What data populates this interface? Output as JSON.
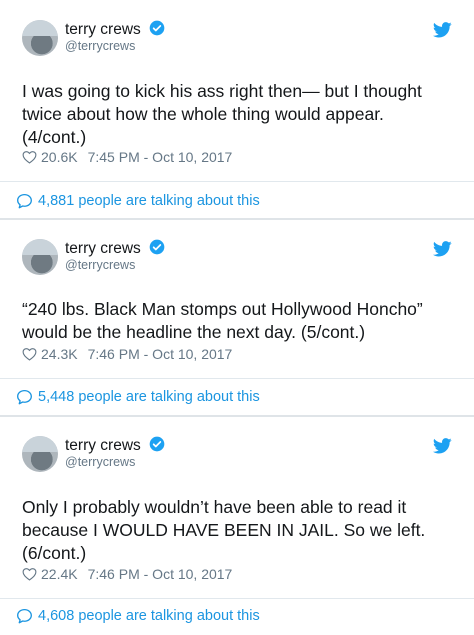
{
  "colors": {
    "link": "#1b95e0",
    "muted": "#657786",
    "text": "#14171a",
    "divider": "#e1e8ed"
  },
  "tweets": [
    {
      "author_name": "terry crews",
      "author_handle": "@terrycrews",
      "text": "I was going to kick his ass right then— but I thought\ntwice about how the whole thing would appear.\n(4/cont.)",
      "likes": "20.6K",
      "timestamp": "7:45 PM - Oct 10, 2017",
      "talking": "4,881 people are talking about this",
      "icons": [
        "avatar",
        "verified-badge-icon",
        "twitter-bird-icon",
        "heart-icon",
        "comment-bubble-icon"
      ]
    },
    {
      "author_name": "terry crews",
      "author_handle": "@terrycrews",
      "text": "“240 lbs. Black Man stomps out Hollywood Honcho”\nwould be the headline the next day. (5/cont.)",
      "likes": "24.3K",
      "timestamp": "7:46 PM - Oct 10, 2017",
      "talking": "5,448 people are talking about this",
      "icons": [
        "avatar",
        "verified-badge-icon",
        "twitter-bird-icon",
        "heart-icon",
        "comment-bubble-icon"
      ]
    },
    {
      "author_name": "terry crews",
      "author_handle": "@terrycrews",
      "text": "Only I probably wouldn’t have been able to read it\nbecause I WOULD HAVE BEEN IN JAIL. So we left.\n(6/cont.)",
      "likes": "22.4K",
      "timestamp": "7:46 PM - Oct 10, 2017",
      "talking": "4,608 people are talking about this",
      "icons": [
        "avatar",
        "verified-badge-icon",
        "twitter-bird-icon",
        "heart-icon",
        "comment-bubble-icon"
      ]
    }
  ]
}
